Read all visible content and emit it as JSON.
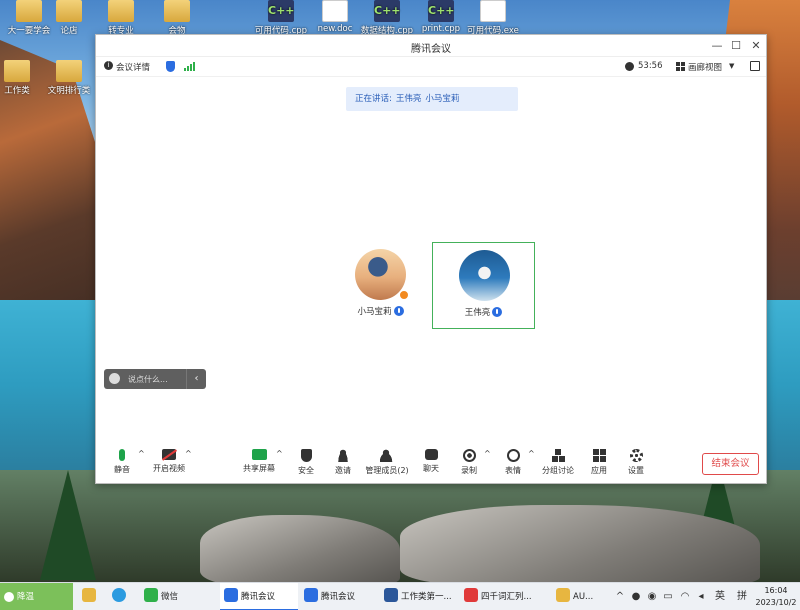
{
  "desktop_icons": [
    {
      "label": "大一要学会",
      "type": "folder"
    },
    {
      "label": "论店",
      "type": "folder"
    },
    {
      "label": "转专业",
      "type": "folder"
    },
    {
      "label": "会物",
      "type": "folder"
    },
    {
      "label": "可用代码.cpp",
      "type": "cpp"
    },
    {
      "label": "new.doc",
      "type": "doc"
    },
    {
      "label": "数据结构.cpp",
      "type": "cpp"
    },
    {
      "label": "print.cpp",
      "type": "cpp"
    },
    {
      "label": "可用代码.exe",
      "type": "doc"
    },
    {
      "label": "工作类",
      "type": "folder"
    },
    {
      "label": "文明排行类",
      "type": "folder"
    }
  ],
  "window": {
    "title": "腾讯会议",
    "minimize": "—",
    "maximize": "☐",
    "close": "✕"
  },
  "infobar": {
    "meeting_details": "会议详情",
    "timer": "53:56",
    "view_mode": "画廊视图"
  },
  "speaking_banner": {
    "prefix": "正在讲话:",
    "names": [
      "王伟亮",
      "小马宝莉"
    ]
  },
  "participants": [
    {
      "name": "小马宝莉",
      "host": true
    },
    {
      "name": "王伟亮",
      "host": false
    }
  ],
  "chat": {
    "placeholder": "说点什么..."
  },
  "toolbar": {
    "mute": "静音",
    "start_video": "开启视频",
    "share_screen": "共享屏幕",
    "security": "安全",
    "invite": "邀请",
    "manage_members": "管理成员(2)",
    "chat": "聊天",
    "record": "录制",
    "reactions": "表情",
    "breakout": "分组讨论",
    "apps": "应用",
    "settings": "设置",
    "end_meeting": "结束会议"
  },
  "taskbar": {
    "weather": "降温",
    "apps": [
      {
        "label": "微信"
      },
      {
        "label": "腾讯会议"
      },
      {
        "label": "腾讯会议"
      },
      {
        "label": "工作类第一..."
      },
      {
        "label": "四千词汇列..."
      },
      {
        "label": "AU..."
      }
    ],
    "ime_lang": "英",
    "ime_mode": "拼",
    "time": "16:04",
    "date": "2023/10/2"
  },
  "colors": {
    "accent": "#2b6de0",
    "active_speaker": "#44b15a",
    "end_meeting": "#e04a4a",
    "mic_on": "#1ea34a"
  }
}
